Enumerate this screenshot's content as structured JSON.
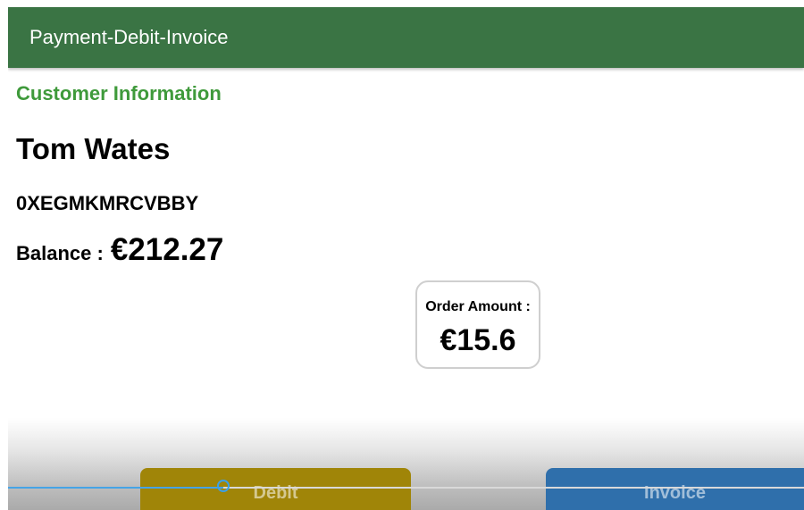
{
  "app_bar": {
    "title": "Payment-Debit-Invoice"
  },
  "customer": {
    "section_title": "Customer Information",
    "name": "Tom Wates",
    "id": "0XEGMKMRCVBBY",
    "balance_label": "Balance :",
    "balance": "€212.27"
  },
  "order": {
    "label": "Order Amount :",
    "amount": "€15.6"
  },
  "actions": {
    "debit_label": "Debit",
    "invoice_label": "Invoice"
  },
  "slider": {
    "value_fraction": 0.27
  },
  "colors": {
    "app_bar": "#3a7444",
    "section_title": "#3f9a3b",
    "debit_button": "#a08508",
    "invoice_button": "#2f6fab",
    "slider_accent": "#46a4e6"
  }
}
